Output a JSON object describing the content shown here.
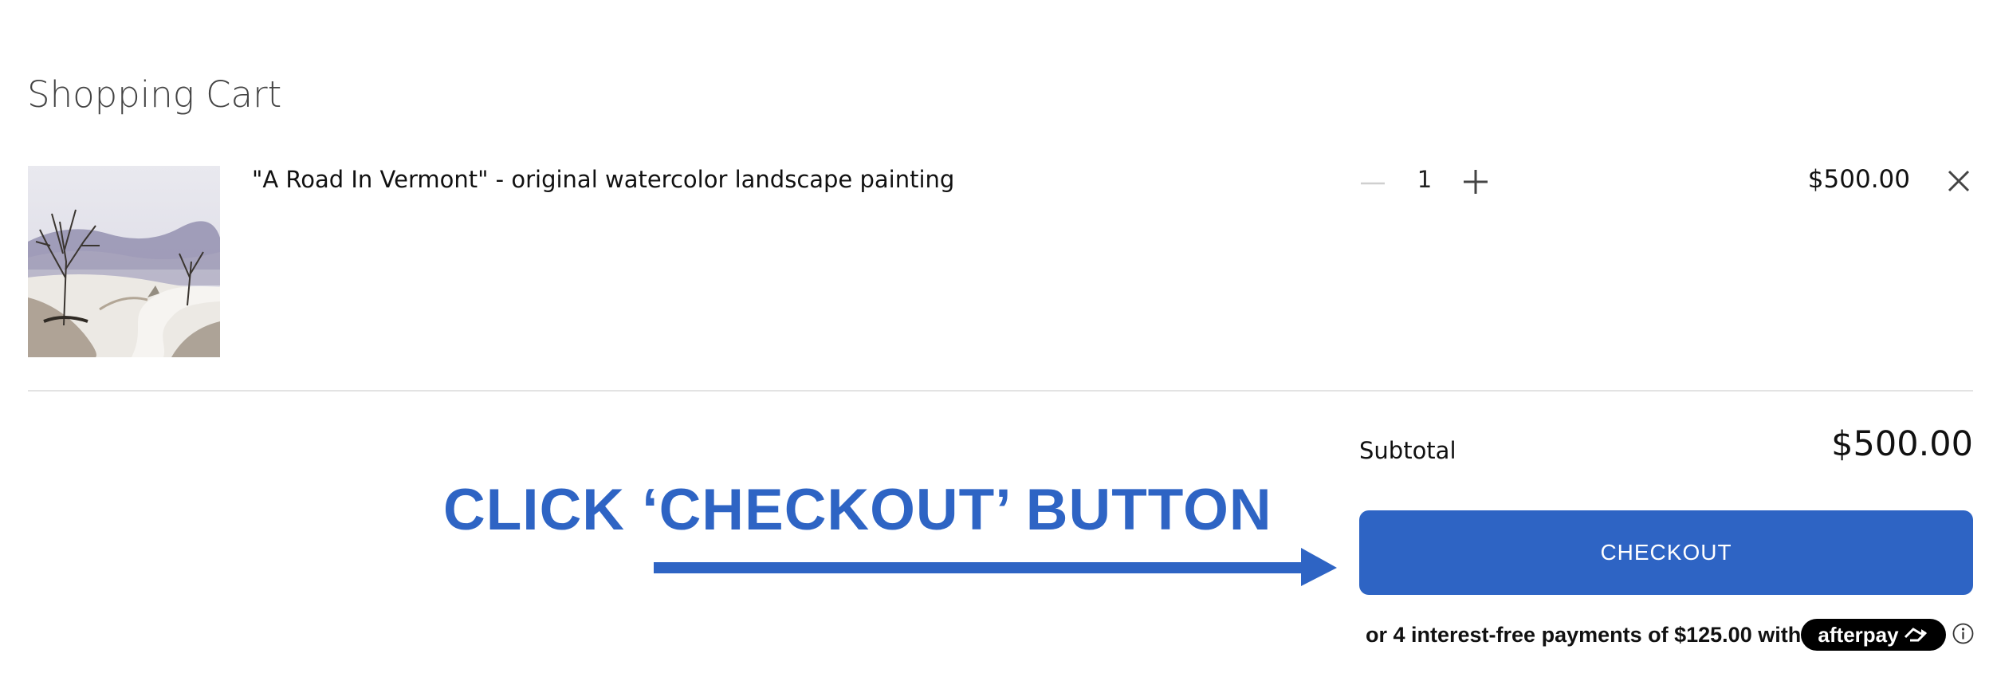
{
  "cart": {
    "title": "Shopping Cart"
  },
  "item": {
    "name": "\"A Road In Vermont\" - original watercolor landscape painting",
    "quantity": "1",
    "price": "$500.00",
    "thumbnail_icon": "watercolor-painting-thumbnail"
  },
  "summary": {
    "subtotal_label": "Subtotal",
    "subtotal_value": "$500.00",
    "checkout_label": "CHECKOUT",
    "afterpay_text": "or 4 interest-free payments of $125.00 with",
    "afterpay_brand": "afterpay"
  },
  "annotation": {
    "text": "CLICK ‘CHECKOUT’ BUTTON"
  },
  "colors": {
    "accent": "#2e64c4",
    "divider": "#e3e3e3",
    "afterpay_badge": "#000000"
  },
  "icons": {
    "minus": "minus-icon",
    "plus": "plus-icon",
    "remove": "close-icon",
    "afterpay_logo": "afterpay-arrows-icon",
    "info": "info-icon",
    "arrow": "arrow-right-icon"
  }
}
